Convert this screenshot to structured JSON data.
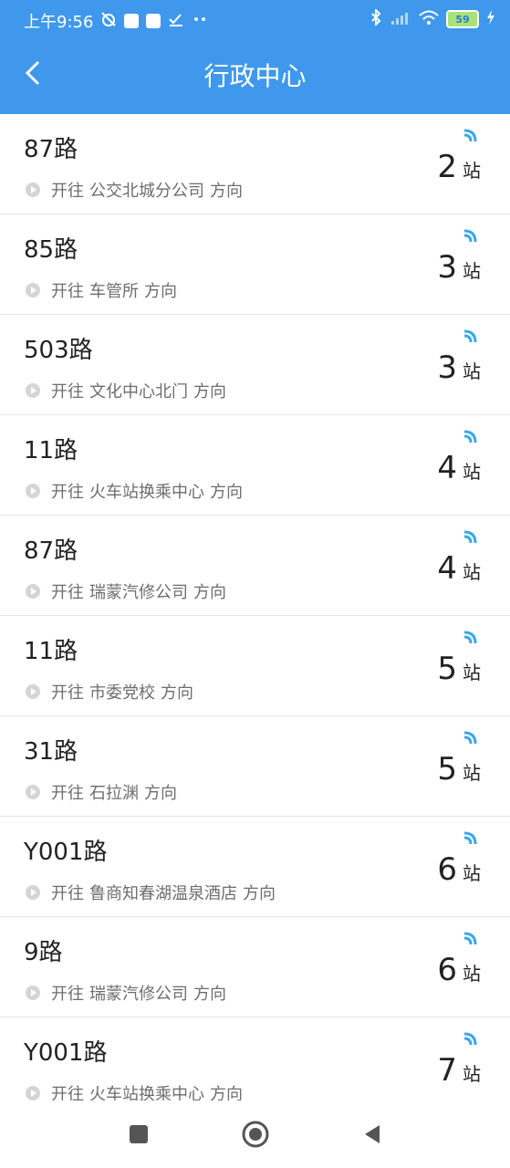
{
  "status": {
    "time": "上午9:56",
    "battery": "59"
  },
  "header": {
    "title": "行政中心"
  },
  "labels": {
    "heading_word": "开往",
    "direction_suffix": "方向",
    "station_unit": "站"
  },
  "routes": [
    {
      "route": "87路",
      "destination": "公交北城分公司",
      "stations": "2"
    },
    {
      "route": "85路",
      "destination": "车管所",
      "stations": "3"
    },
    {
      "route": "503路",
      "destination": "文化中心北门",
      "stations": "3"
    },
    {
      "route": "11路",
      "destination": "火车站换乘中心",
      "stations": "4"
    },
    {
      "route": "87路",
      "destination": "瑞蒙汽修公司",
      "stations": "4"
    },
    {
      "route": "11路",
      "destination": "市委党校",
      "stations": "5"
    },
    {
      "route": "31路",
      "destination": "石拉渊",
      "stations": "5"
    },
    {
      "route": "Y001路",
      "destination": "鲁商知春湖温泉酒店",
      "stations": "6"
    },
    {
      "route": "9路",
      "destination": "瑞蒙汽修公司",
      "stations": "6"
    },
    {
      "route": "Y001路",
      "destination": "火车站换乘中心",
      "stations": "7"
    }
  ],
  "colors": {
    "primary": "#3f98ec",
    "signal": "#3aa8e8"
  }
}
